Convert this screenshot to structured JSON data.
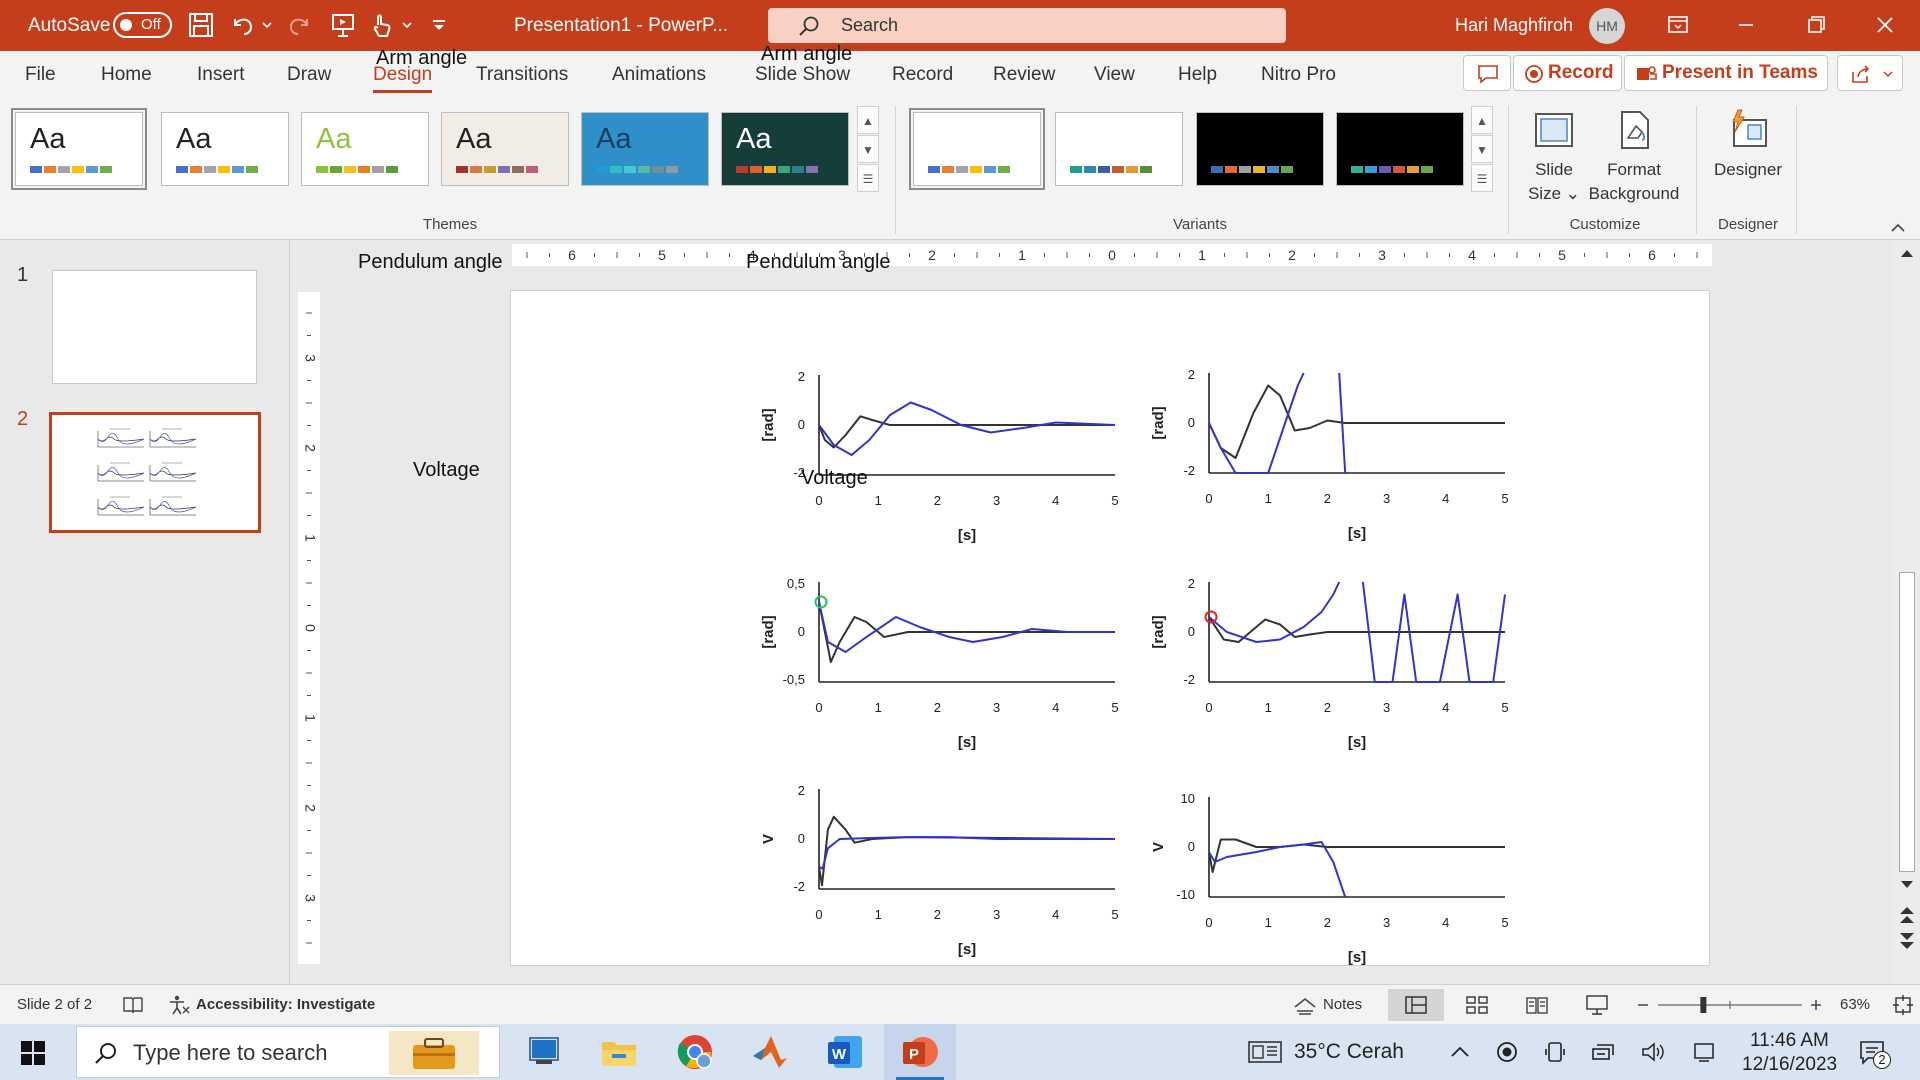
{
  "titlebar": {
    "autosave_label": "AutoSave",
    "autosave_state": "Off",
    "document_title": "Presentation1  -  PowerP...",
    "search_placeholder": "Search",
    "user_name": "Hari Maghfiroh",
    "user_initials": "HM",
    "accent_color": "#c43e1c"
  },
  "ribbon_tabs": [
    "File",
    "Home",
    "Insert",
    "Draw",
    "Design",
    "Transitions",
    "Animations",
    "Slide Show",
    "Record",
    "Review",
    "View",
    "Help",
    "Nitro Pro"
  ],
  "ribbon_active_tab": "Design",
  "ribbon_right": {
    "record_label": "Record",
    "present_label": "Present in Teams"
  },
  "themes": {
    "group_label": "Themes",
    "aa_text": "Aa",
    "items": [
      {
        "bg": "#ffffff",
        "fg": "#222222",
        "colors": [
          "#4472c4",
          "#ed7d31",
          "#a5a5a5",
          "#ffc000",
          "#5b9bd5",
          "#70ad47"
        ]
      },
      {
        "bg": "#ffffff",
        "fg": "#222222",
        "colors": [
          "#4472c4",
          "#ed7d31",
          "#a5a5a5",
          "#ffc000",
          "#5b9bd5",
          "#70ad47"
        ]
      },
      {
        "bg": "#ffffff",
        "fg": "#8ac43f",
        "colors": [
          "#8ac43f",
          "#6ba72f",
          "#f2c314",
          "#e5801c",
          "#a0a0a0",
          "#5c9c3a"
        ]
      },
      {
        "bg": "#f2ece6",
        "fg": "#222222",
        "colors": [
          "#a5312a",
          "#d97a46",
          "#c99a2e",
          "#7d6fb0",
          "#8b6f5a",
          "#c05e78"
        ]
      },
      {
        "bg": "#2f8fc9",
        "fg": "#1c3e5e",
        "colors": [
          "#1f9bd7",
          "#2dbfc4",
          "#44c8d9",
          "#5bb9a4",
          "#6e8fa0",
          "#8c9ba5"
        ]
      },
      {
        "bg": "#153e3a",
        "fg": "#ffffff",
        "colors": [
          "#c0392b",
          "#e55b2a",
          "#f2b01d",
          "#3aa57e",
          "#2e7f8a",
          "#8a6fb5"
        ]
      }
    ]
  },
  "variants": {
    "group_label": "Variants",
    "items": [
      {
        "bg": "#ffffff",
        "colors": [
          "#4472c4",
          "#ed7d31",
          "#a5a5a5",
          "#ffc000",
          "#5b9bd5",
          "#70ad47"
        ]
      },
      {
        "bg": "#ffffff",
        "colors": [
          "#1f9e89",
          "#2a8bb6",
          "#3a5fa8",
          "#c85a2d",
          "#e39b2e",
          "#5b8c3a"
        ]
      },
      {
        "bg": "#000000",
        "colors": [
          "#3d6fb4",
          "#e66b2e",
          "#a0a0a0",
          "#e8b628",
          "#4b8ec8",
          "#6aa84f"
        ]
      },
      {
        "bg": "#000000",
        "colors": [
          "#2fb393",
          "#3a9ed6",
          "#6b5bb5",
          "#d05a3c",
          "#e3a42f",
          "#6aa84f"
        ]
      }
    ]
  },
  "customize": {
    "group_label": "Customize",
    "slide_size_label_1": "Slide",
    "slide_size_label_2": "Size",
    "format_bg_label_1": "Format",
    "format_bg_label_2": "Background"
  },
  "designer": {
    "group_label": "Designer",
    "button_label": "Designer"
  },
  "thumbnails": [
    {
      "number": "1",
      "selected": false
    },
    {
      "number": "2",
      "selected": true
    }
  ],
  "ruler": {
    "horizontal_labels": [
      "6",
      "5",
      "4",
      "3",
      "2",
      "1",
      "0",
      "1",
      "2",
      "3",
      "4",
      "5",
      "6"
    ],
    "vertical_labels": [
      "3",
      "2",
      "1",
      "0",
      "1",
      "2",
      "3"
    ]
  },
  "slide_charts": [
    {
      "title": "Arm angle",
      "ylabel": "[rad]",
      "xlabel": "[s]",
      "yticks": [
        "2",
        "0",
        "-2"
      ],
      "xticks": [
        "0",
        "1",
        "2",
        "3",
        "4",
        "5"
      ],
      "ylim": [
        -2,
        2
      ],
      "xlim": [
        0,
        5
      ],
      "marker": null,
      "series": [
        {
          "color": "#333333",
          "points": [
            [
              0,
              0
            ],
            [
              0.1,
              -0.6
            ],
            [
              0.25,
              -0.9
            ],
            [
              0.45,
              -0.4
            ],
            [
              0.7,
              0.35
            ],
            [
              0.9,
              0.2
            ],
            [
              1.2,
              0
            ],
            [
              1.6,
              0
            ],
            [
              2.5,
              0
            ],
            [
              5,
              0
            ]
          ]
        },
        {
          "color": "#3333cc",
          "points": [
            [
              0,
              0
            ],
            [
              0.25,
              -0.8
            ],
            [
              0.55,
              -1.2
            ],
            [
              0.85,
              -0.6
            ],
            [
              1.2,
              0.4
            ],
            [
              1.55,
              0.9
            ],
            [
              1.9,
              0.6
            ],
            [
              2.4,
              0
            ],
            [
              2.9,
              -0.3
            ],
            [
              3.5,
              -0.1
            ],
            [
              4,
              0.1
            ],
            [
              4.5,
              0.05
            ],
            [
              5,
              0
            ]
          ]
        }
      ]
    },
    {
      "title": "Arm angle",
      "ylabel": "[rad]",
      "xlabel": "[s]",
      "yticks": [
        "2",
        "0",
        "-2"
      ],
      "xticks": [
        "0",
        "1",
        "2",
        "3",
        "4",
        "5"
      ],
      "ylim": [
        -2,
        2
      ],
      "xlim": [
        0,
        5
      ],
      "marker": null,
      "series": [
        {
          "color": "#333333",
          "points": [
            [
              0,
              0
            ],
            [
              0.2,
              -1
            ],
            [
              0.45,
              -1.4
            ],
            [
              0.75,
              0.4
            ],
            [
              1,
              1.5
            ],
            [
              1.2,
              1.1
            ],
            [
              1.45,
              -0.3
            ],
            [
              1.7,
              -0.2
            ],
            [
              2,
              0.1
            ],
            [
              2.3,
              0
            ],
            [
              3,
              0
            ],
            [
              5,
              0
            ]
          ]
        },
        {
          "color": "#3333cc",
          "points": [
            [
              0,
              0
            ],
            [
              0.2,
              -1
            ],
            [
              0.45,
              -2
            ],
            [
              1,
              -2
            ],
            [
              1.5,
              1.5
            ],
            [
              1.6,
              2
            ]
          ]
        },
        {
          "color": "#3333cc",
          "points": [
            [
              2.2,
              2
            ],
            [
              2.3,
              -2
            ]
          ]
        }
      ]
    },
    {
      "title": "Pendulum angle",
      "ylabel": "[rad]",
      "xlabel": "[s]",
      "yticks": [
        "0,5",
        "0",
        "-0,5"
      ],
      "xticks": [
        "0",
        "1",
        "2",
        "3",
        "4",
        "5"
      ],
      "ylim": [
        -0.5,
        0.5
      ],
      "xlim": [
        0,
        5
      ],
      "marker": {
        "color": "#22c55e",
        "x": 0,
        "y": 0.3
      },
      "series": [
        {
          "color": "#333333",
          "points": [
            [
              0,
              0.3
            ],
            [
              0.1,
              0
            ],
            [
              0.2,
              -0.3
            ],
            [
              0.35,
              -0.1
            ],
            [
              0.6,
              0.15
            ],
            [
              0.8,
              0.1
            ],
            [
              1.1,
              -0.05
            ],
            [
              1.5,
              0
            ],
            [
              5,
              0
            ]
          ]
        },
        {
          "color": "#3333cc",
          "points": [
            [
              0,
              0.3
            ],
            [
              0.15,
              -0.1
            ],
            [
              0.45,
              -0.2
            ],
            [
              0.8,
              -0.05
            ],
            [
              1.3,
              0.15
            ],
            [
              1.7,
              0.05
            ],
            [
              2.2,
              -0.05
            ],
            [
              2.6,
              -0.1
            ],
            [
              3.1,
              -0.05
            ],
            [
              3.6,
              0.03
            ],
            [
              4.2,
              0
            ],
            [
              5,
              0
            ]
          ]
        }
      ]
    },
    {
      "title": "Pendulum angle",
      "ylabel": "[rad]",
      "xlabel": "[s]",
      "yticks": [
        "2",
        "0",
        "-2"
      ],
      "xticks": [
        "0",
        "1",
        "2",
        "3",
        "4",
        "5"
      ],
      "ylim": [
        -2,
        2
      ],
      "xlim": [
        0,
        5
      ],
      "marker": {
        "color": "#dc2626",
        "x": 0,
        "y": 0.6
      },
      "series": [
        {
          "color": "#333333",
          "points": [
            [
              0,
              0.6
            ],
            [
              0.25,
              -0.3
            ],
            [
              0.5,
              -0.4
            ],
            [
              0.7,
              0
            ],
            [
              0.95,
              0.5
            ],
            [
              1.2,
              0.3
            ],
            [
              1.45,
              -0.2
            ],
            [
              1.7,
              -0.1
            ],
            [
              2,
              0
            ],
            [
              5,
              0
            ]
          ]
        },
        {
          "color": "#3333cc",
          "points": [
            [
              0,
              0.6
            ],
            [
              0.3,
              0
            ],
            [
              0.8,
              -0.4
            ],
            [
              1.2,
              -0.3
            ],
            [
              1.6,
              0.2
            ],
            [
              1.9,
              0.8
            ],
            [
              2.1,
              1.5
            ],
            [
              2.2,
              2
            ]
          ]
        },
        {
          "color": "#3333cc",
          "points": [
            [
              2.6,
              2
            ],
            [
              2.8,
              -2
            ],
            [
              3.1,
              -2
            ],
            [
              3.3,
              1.5
            ],
            [
              3.5,
              -2
            ],
            [
              3.9,
              -2
            ],
            [
              4.2,
              1.5
            ],
            [
              4.4,
              -2
            ],
            [
              4.8,
              -2
            ],
            [
              5,
              1.5
            ]
          ]
        }
      ]
    },
    {
      "title": "Voltage",
      "ylabel": "V",
      "xlabel": "[s]",
      "yticks": [
        "2",
        "0",
        "-2"
      ],
      "xticks": [
        "0",
        "1",
        "2",
        "3",
        "4",
        "5"
      ],
      "ylim": [
        -2.7,
        2.7
      ],
      "xlim": [
        0,
        5
      ],
      "marker": null,
      "series": [
        {
          "color": "#333333",
          "points": [
            [
              0,
              -1.5
            ],
            [
              0.05,
              -2.5
            ],
            [
              0.15,
              0.5
            ],
            [
              0.25,
              1.2
            ],
            [
              0.45,
              0.5
            ],
            [
              0.6,
              -0.2
            ],
            [
              0.9,
              0
            ],
            [
              1.5,
              0.1
            ],
            [
              5,
              0
            ]
          ]
        },
        {
          "color": "#3333cc",
          "points": [
            [
              0,
              -1.5
            ],
            [
              0.06,
              -1.6
            ],
            [
              0.15,
              -0.5
            ],
            [
              0.35,
              0
            ],
            [
              0.8,
              0.05
            ],
            [
              1.5,
              0.1
            ],
            [
              2.2,
              0.1
            ],
            [
              3,
              0
            ],
            [
              5,
              0
            ]
          ]
        }
      ]
    },
    {
      "title": "Voltage",
      "ylabel": "V",
      "xlabel": "[s]",
      "yticks": [
        "10",
        "0",
        "-10"
      ],
      "xticks": [
        "0",
        "1",
        "2",
        "3",
        "4",
        "5"
      ],
      "ylim": [
        -10,
        10
      ],
      "xlim": [
        0,
        5
      ],
      "marker": null,
      "series": [
        {
          "color": "#333333",
          "points": [
            [
              0,
              -1
            ],
            [
              0.06,
              -5
            ],
            [
              0.2,
              1.5
            ],
            [
              0.45,
              1.5
            ],
            [
              0.8,
              0
            ],
            [
              1.2,
              0
            ],
            [
              1.6,
              0.5
            ],
            [
              2,
              0
            ],
            [
              5,
              0
            ]
          ]
        },
        {
          "color": "#3333cc",
          "points": [
            [
              0,
              -1
            ],
            [
              0.1,
              -3
            ],
            [
              0.3,
              -2
            ],
            [
              0.8,
              -1
            ],
            [
              1.2,
              0
            ],
            [
              1.6,
              0.5
            ],
            [
              1.9,
              1
            ],
            [
              2.1,
              -3
            ],
            [
              2.3,
              -10
            ]
          ]
        }
      ]
    }
  ],
  "statusbar": {
    "slide_info": "Slide 2 of 2",
    "accessibility": "Accessibility: Investigate",
    "notes_label": "Notes",
    "zoom_label": "63%",
    "zoom_percent": 63
  },
  "taskbar": {
    "search_placeholder": "Type here to search",
    "weather": "35°C  Cerah",
    "time": "11:46 AM",
    "date": "12/16/2023",
    "notification_count": "2"
  }
}
